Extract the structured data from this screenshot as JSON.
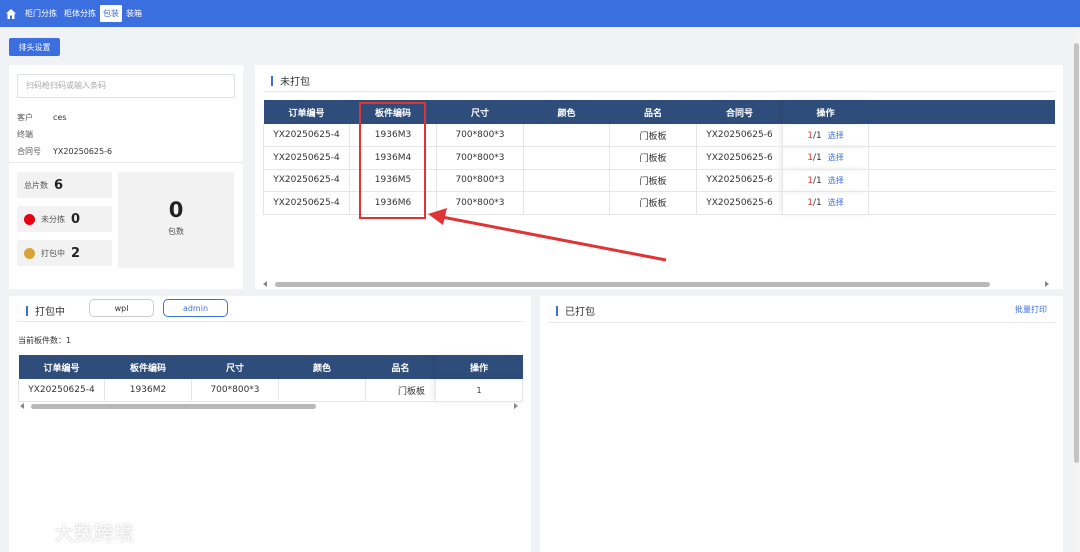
{
  "nav": {
    "items": [
      {
        "label": "柜门分拣",
        "active": false
      },
      {
        "label": "柜体分拣",
        "active": false
      },
      {
        "label": "包装",
        "active": true
      },
      {
        "label": "装箱",
        "active": false
      }
    ]
  },
  "header_button": "排头设置",
  "left": {
    "scan_placeholder": "扫码枪扫码或输入条码",
    "customer_label": "客户",
    "customer_value": "ces",
    "terminal_label": "终端",
    "terminal_value": "",
    "contract_label": "合同号",
    "contract_value": "YX20250625-6",
    "total_label": "总片数",
    "total_value": "6",
    "unsorted_label": "未分拣",
    "unsorted_value": "0",
    "packing_label": "打包中",
    "packing_value": "2",
    "bag_count": "0",
    "bag_label": "包数",
    "colors": {
      "unsorted": "#e60012",
      "packing": "#d9a437"
    }
  },
  "unpacked": {
    "title": "未打包",
    "columns": [
      "订单编号",
      "板件编码",
      "尺寸",
      "颜色",
      "品名",
      "合同号",
      "操作"
    ],
    "rows": [
      {
        "order": "YX20250625-4",
        "code": "1936M3",
        "size": "700*800*3",
        "color": "",
        "name": "门板板",
        "contract": "YX20250625-6",
        "op_num": "1",
        "op_den": "/1",
        "op_link": "选择"
      },
      {
        "order": "YX20250625-4",
        "code": "1936M4",
        "size": "700*800*3",
        "color": "",
        "name": "门板板",
        "contract": "YX20250625-6",
        "op_num": "1",
        "op_den": "/1",
        "op_link": "选择"
      },
      {
        "order": "YX20250625-4",
        "code": "1936M5",
        "size": "700*800*3",
        "color": "",
        "name": "门板板",
        "contract": "YX20250625-6",
        "op_num": "1",
        "op_den": "/1",
        "op_link": "选择"
      },
      {
        "order": "YX20250625-4",
        "code": "1936M6",
        "size": "700*800*3",
        "color": "",
        "name": "门板板",
        "contract": "YX20250625-6",
        "op_num": "1",
        "op_den": "/1",
        "op_link": "选择"
      }
    ]
  },
  "packing": {
    "title": "打包中",
    "users": [
      "wpl",
      "admin"
    ],
    "count_label": "当前板件数：1",
    "columns": [
      "订单编号",
      "板件编码",
      "尺寸",
      "颜色",
      "品名",
      "操作"
    ],
    "rows": [
      {
        "order": "YX20250625-4",
        "code": "1936M2",
        "size": "700*800*3",
        "color": "",
        "name": "门板板",
        "op": "1"
      }
    ]
  },
  "packed": {
    "title": "已打包",
    "batch_print": "批量打印"
  },
  "watermark": "大数跨境",
  "accent": "#3b6fe0",
  "annotation_color": "#e03434"
}
